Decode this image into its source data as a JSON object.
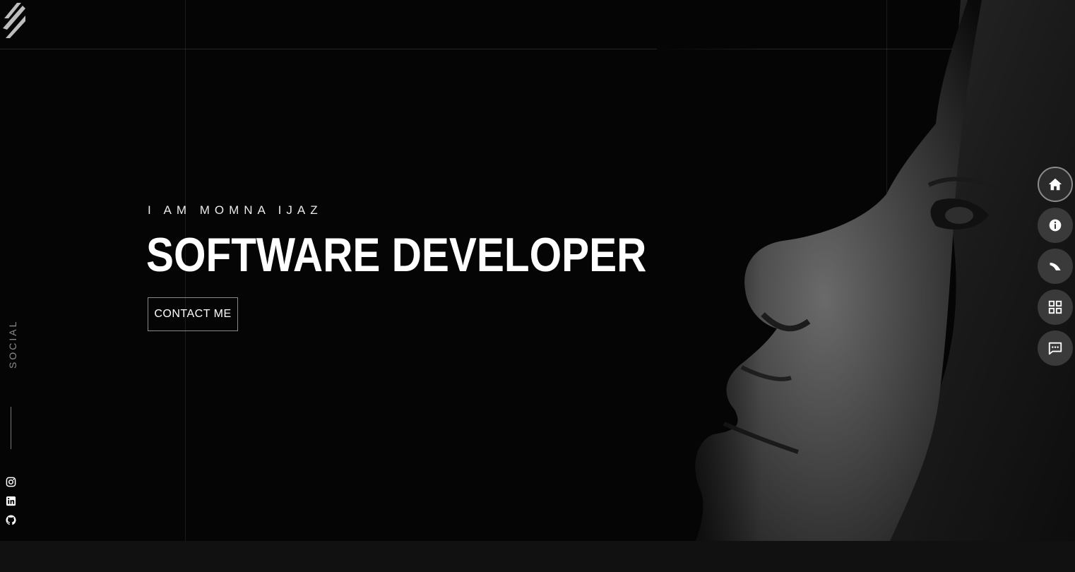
{
  "hero": {
    "intro": "I AM MOMNA IJAZ",
    "title": "SOFTWARE DEVELOPER",
    "contact_label": "CONTACT ME"
  },
  "social": {
    "label": "SOCIAL",
    "icons": [
      "instagram-icon",
      "linkedin-icon",
      "github-icon"
    ]
  },
  "side_nav": {
    "items": [
      "home-icon",
      "info-icon",
      "services-icon",
      "portfolio-icon",
      "chat-icon"
    ],
    "active": "home-icon"
  },
  "colors": {
    "background": "#050505",
    "footer": "#111111",
    "nav_button": "#3a3a3a",
    "text": "#ffffff",
    "muted": "#8a8a8a"
  }
}
